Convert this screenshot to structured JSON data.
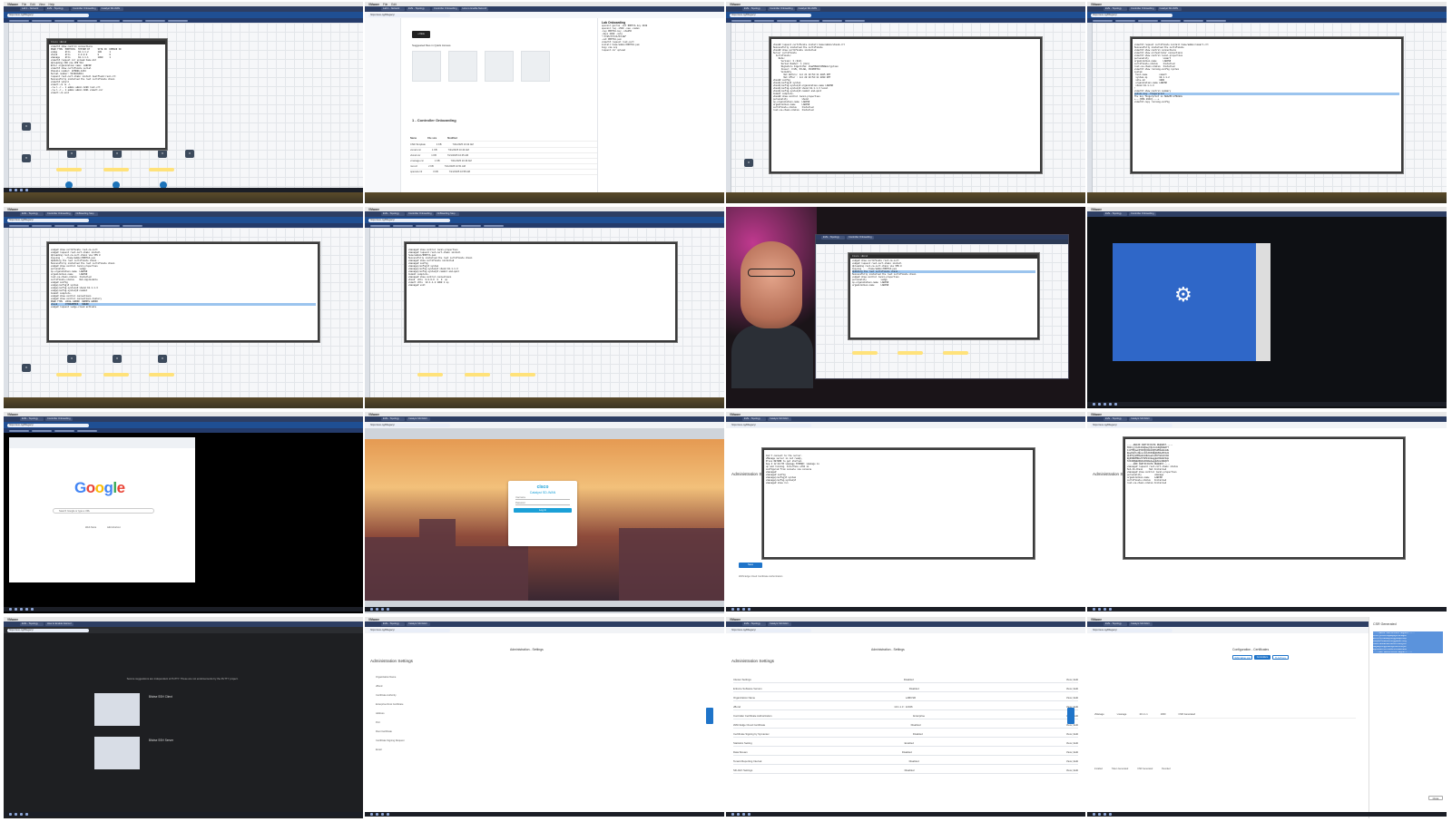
{
  "menubar": {
    "app": "VMware",
    "items": [
      "File",
      "Edit",
      "View",
      "History",
      "Bookmarks",
      "Profiles",
      "Tab",
      "Window",
      "Help"
    ]
  },
  "tabs": [
    "Lab 1 - Network",
    "EVE - Topology",
    "Controller Onboarding",
    "Catalyst SD-WAN",
    "How to Enable Netconf",
    "OnBoarding Step",
    "Cisco - TRAP v2 Configuration"
  ],
  "address": "https://eve-ng/#/legacy/",
  "t1": {
    "terminal_title": "Cisco vBond",
    "lines": [
      "vsmart# show control connections",
      "PEER TYPE  PROTOCOL  SYSTEM IP      SITE ID  DOMAIN ID",
      "vedge      dtls      10.1.1.2       100      1",
      "vbond      dtls      0.0.0.0        0        0",
      "vmanage    dtls      10.1.1.1       1000     1",
      "vsmart# request csr upload home-dir",
      "Uploading CSR via VPN 512",
      "Enter organization name: LABCSR",
      "vsmart# show certificate serial",
      "Chassis number: 8C5B9A-12F4",
      "Serial number: 5A7E3C2D11",
      "request root-cert-chain install bootflash:root.crt",
      "Successfully installed the root certificate chain",
      "vsmart# vshell",
      "vsmart:~$ ls -l",
      "-rw-r--r-- 1 admin admin 1289 root.crt",
      "-rw-r--r-- 1 admin admin 1001 vsmart.csr",
      "vsmart:~$ exit"
    ]
  },
  "t2": {
    "title": "Lab Onboarding",
    "new_button": "+ New",
    "suggested": "Suggested files in Quick Access",
    "folder": "1 - Controller Onboarding",
    "columns": [
      "Name",
      "File size",
      "Modified"
    ],
    "files": [
      {
        "name": "CSR-Template",
        "size": "4 KB",
        "date": "7/21/2025 10:42 AM"
      },
      {
        "name": "vsmart.csr",
        "size": "1 KB",
        "date": "7/21/2025 10:44 AM"
      },
      {
        "name": "vbond.csr",
        "size": "1 KB",
        "date": "7/21/2025 10:45 AM"
      },
      {
        "name": "vmanage.csr",
        "size": "1 KB",
        "date": "7/21/2025 10:46 AM"
      },
      {
        "name": "root.crt",
        "size": "2 KB",
        "date": "7/21/2025 10:51 AM"
      },
      {
        "name": "openssl.cnf",
        "size": "3 KB",
        "date": "7/21/2025 10:58 AM"
      }
    ],
    "notes": [
      "openssl genrsa -out ROOTCA.key 2048",
      "openssl req -x509 -new -nodes",
      "-key ROOTCA.key -sha256",
      "-days 2000 -subj",
      "\"/C=US/ST=CA/O=LAB\"",
      "-out ROOTCA.pem",
      "",
      "vsmart# request root-cert",
      "install home/admin/ROOTCA.pem",
      "",
      "Copy via scp",
      "",
      "request csr upload"
    ]
  },
  "t3": {
    "lines": [
      "vbond# request certificate install home/admin/vbond.crt",
      "Successfully installed the certificate",
      "vbond# show certificate installed",
      "Server certificate",
      "  Certificate:",
      "    Data:",
      "      Version: 3 (0x2)",
      "      Serial Number: 1 (0x1)",
      "      Signature Algorithm: sha256WithRSAEncryption",
      "      Issuer: C=US, O=LAB, CN=ROOTCA",
      "      Validity",
      "        Not Before: Jul 21 10:52:11 2025 GMT",
      "        Not After : Jul 20 10:52:11 2030 GMT",
      "vbond# config",
      "vbond(config)# system",
      "vbond(config-system)# organization-name LABCSR",
      "vbond(config-system)# vbond 10.1.1.3 local",
      "vbond(config-system)# commit and-quit",
      "Commit complete.",
      "vbond# show control local-properties",
      "personality           vbond",
      "sp-organization-name  LABCSR",
      "organization-name     LABCSR",
      "certificate-status    Installed",
      "root-ca-chain-status  Installed"
    ]
  },
  "t4": {
    "lines": [
      "vsmart# request certificate install home/admin/vsmart.crt",
      "Successfully installed the certificate",
      "vsmart# show control connections",
      "vsmart# show orchestrator connections",
      "vsmart# show control local-properties",
      "personality           vsmart",
      "organization-name     LABCSR",
      "certificate-status    Installed",
      "root-ca-chain-status  Installed",
      "vsmart# show running-config system",
      "system",
      " host-name         vsmart",
      " system-ip         10.1.1.2",
      " site-id           1000",
      " organization-name LABCSR",
      " vbond 10.1.1.3",
      "!",
      "vsmart# show control summary",
      "public-key  fingerprint",
      "The key fingerprint is SHA256:8fD2k0x",
      "+---[RSA 2048]----+",
      "vsmart# copy running-config"
    ]
  },
  "t5": {
    "lines": [
      "vedge# show certificate root-ca-cert",
      "vedge# request root-cert-chain install",
      "Uploading root-ca-cert-chain via VPN 0",
      "Copying ... /home/admin/ROOTCA.pem",
      "Updating the root certificate chain..",
      "Successfully installed the root certificate chain",
      "vedge# show control local-properties",
      "personality           vedge",
      "sp-organization-name  LABCSR",
      "organization-name     LABCSR",
      "root-ca-chain-status  Installed",
      "certificate-status    Not-Applicable",
      "vedge# config",
      "vedge(config)# system",
      "vedge(config-system)# vbond 10.1.1.3",
      "vedge(config-system)# commit",
      "Commit complete.",
      "vedge# show control connections",
      "vedge# show control connections-history",
      "PEER TYPE  LOCAL ERROR  REMOTE ERROR",
      "vbond      CTORGNMMIS   NOERR",
      "vedge# request vedge-cloud activate"
    ]
  },
  "t6": {
    "lines": [
      "vmanage# show control local-properties",
      "vmanage# request root-cert-chain install",
      "home/admin/ROOTCA.pem",
      "Successfully installed the root certificate chain",
      "vmanage# show certificate installed",
      "vmanage# config",
      "vmanage(config)# system",
      "vmanage(config-system)# vbond 10.1.1.3",
      "vmanage(config-system)# commit and-quit",
      "Commit complete.",
      "vmanage# show control connections",
      "vbond  dtls  0.0.0.0  0  0  up",
      "vsmart dtls  10.1.1.2 1000 1 up",
      "vmanage# exit"
    ]
  },
  "t7": {
    "pip_title": "Cisco vBond"
  },
  "t8": {
    "dialog_icon": "gear"
  },
  "t9": {
    "search_placeholder": "Search Google or type a URL",
    "shortcuts": [
      "Web Store",
      "Add shortcut"
    ]
  },
  "t10": {
    "brand": "cisco",
    "product": "Catalyst SD-WAN",
    "username_label": "Username",
    "password_label": "Password",
    "login_button": "Log In"
  },
  "t11": {
    "page_title": "Administration Settings",
    "term_lines": [
      "Can't connect to the server.",
      "",
      "vManage server is not ready,",
      "",
      "Press RETURN to get started.",
      "",
      "",
      "",
      "Aug 3 12:10:55 vmanage SYSMGR: vmanage is",
      "up and running. Interface eth0 is",
      "configured from console via console",
      "vmanage#",
      "vmanage# config",
      "vmanage(config)# system",
      "vmanage(config-system)# ",
      "vmanage# show run"
    ],
    "save_button": "Save",
    "footer": "WAN Edge Cloud Certificate Authorization"
  },
  "t12": {
    "lines": [
      "-----BEGIN CERTIFICATE REQUEST-----",
      "MIICyjCCAbICAQAwgYQxCzAJBgNVBAYT",
      "AlVTMQswCQYDVQQIDAJDQTERMA8GA1UE",
      "BwwIU2FuIEpvc2UxFDASBgNVBAoMC0xB",
      "QkNTUjEOMAwGA1UECwwFc2R3YW4xDzAN",
      "BgNVBAMMBnZtYW5hZ2UwggEiMA0GCSqG",
      "SIb3DQEBAQUAA4IBDwAwggEKAoIBAQC5",
      "-----END CERTIFICATE REQUEST-----",
      "",
      "vmanage# request root-cert-chain status",
      "Sub-CA-Chain     Not Installed",
      "vmanage# show control local-properties",
      "personality          vmanage",
      "organization-name    LABCSR",
      "certificate-status   Installed",
      "root-ca-chain-status Installed"
    ]
  },
  "t13": {
    "heading": "Secure suggestions are independent of PuTTY. These are not endorsements by the PuTTY project.",
    "item1": "Bitvise SSH Client",
    "item2": "Bitvise SSH Server"
  },
  "t14": {
    "page_title": "Administration - Settings",
    "section": "Administration Settings",
    "labels": [
      "Organization Name",
      "vBond",
      "Certificate Authority",
      "Enterprise Root Certificate",
      "Address",
      "Port",
      "Root Certificate",
      "Certificate Signing Request",
      "Email"
    ],
    "save": "Save"
  },
  "t15": {
    "page_title": "Administration - Settings",
    "section": "Administration Settings",
    "rows": [
      {
        "label": "Cluster Settings",
        "value": "Disabled"
      },
      {
        "label": "Enforce Software Version",
        "value": "Disabled"
      },
      {
        "label": "Organization Name",
        "value": "LABCSR"
      },
      {
        "label": "vBond",
        "value": "10.1.1.3 : 12346"
      },
      {
        "label": "Controller Certificate Authorization",
        "value": "Enterprise"
      },
      {
        "label": "WAN Edge Cloud Certificate",
        "value": "Disabled"
      },
      {
        "label": "Certificate Signing by Symantec",
        "value": "Disabled"
      },
      {
        "label": "Statistics Setting",
        "value": "Enabled"
      },
      {
        "label": "Data Stream",
        "value": "Disabled"
      },
      {
        "label": "Tenant Reporting Interval",
        "value": "Disabled"
      },
      {
        "label": "SD-AVC Settings",
        "value": "Disabled"
      }
    ],
    "edit_label": "View | Edit"
  },
  "t16": {
    "page_title": "Configuration - Certificates",
    "tabs": [
      "WAN Edge List",
      "Controllers",
      "TLS Proxy"
    ],
    "panel_title": "CSR Generated",
    "device_row": {
      "type": "vManage",
      "hostname": "vmanage",
      "system_ip": "10.1.1.1",
      "site": "1000",
      "status": "CSR Generated"
    },
    "footer_items": [
      "Installed",
      "Token Generated",
      "CSR Generated",
      "Revoked"
    ],
    "csr_lines": [
      "-----BEGIN CERTIFICATE REQUEST-----",
      "MIIC2jCCAcICAQAwgZQxCzAJBgNV",
      "BAYTAlVTMRMwEQYDVQQIEwpDYWxp",
      "Zm9ybmlhMREwDwYDVQQHEwhTYW4g",
      "Sm9zZTEUMBIGA1UEChMLTEFCQ1NS",
      "MRQwEgYDVQQLEwtMQUJDU1IxHjAc",
      "BgNVBAMTFXZtYW5hZ2UtZGM0YmU0",
      "-----END CERTIFICATE REQUEST-----"
    ],
    "close": "Close"
  }
}
